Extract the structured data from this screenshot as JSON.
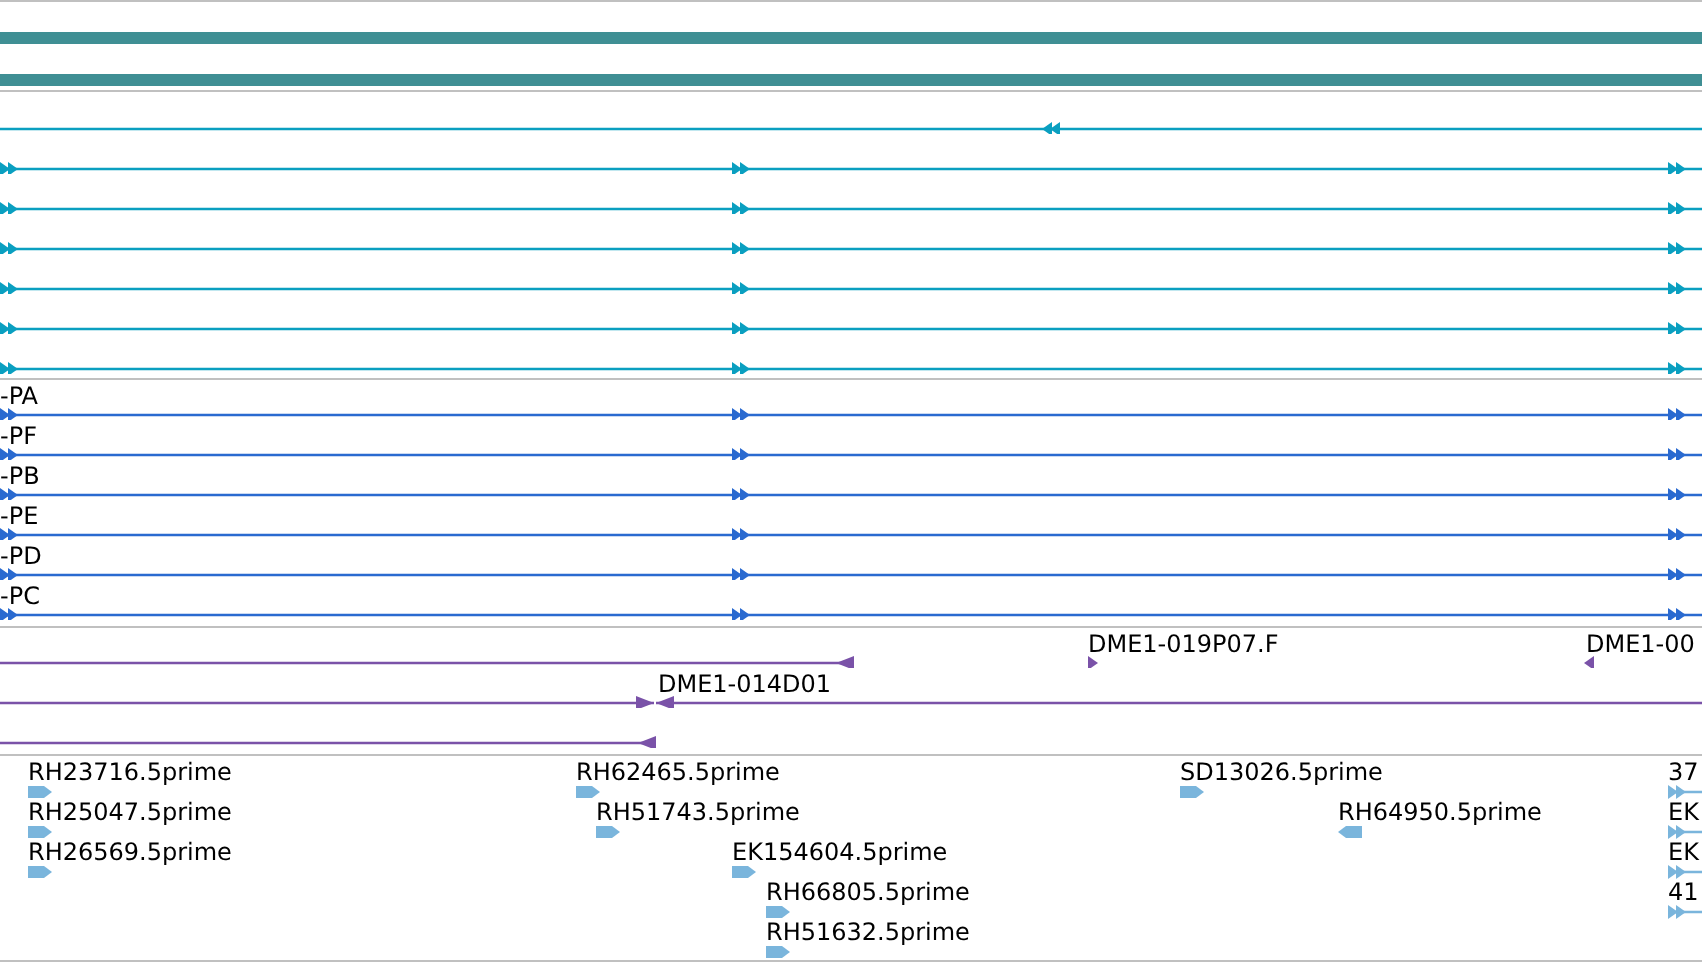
{
  "transcript_track": {
    "rows": [
      {
        "kind": "reverse"
      },
      {
        "kind": "forward"
      },
      {
        "kind": "forward"
      },
      {
        "kind": "forward"
      },
      {
        "kind": "forward"
      },
      {
        "kind": "forward"
      },
      {
        "kind": "forward"
      }
    ]
  },
  "protein_track": {
    "rows": [
      {
        "label": "-PA",
        "kind": "forward"
      },
      {
        "label": "-PF",
        "kind": "forward"
      },
      {
        "label": "-PB",
        "kind": "forward"
      },
      {
        "label": "-PE",
        "kind": "forward"
      },
      {
        "label": "-PD",
        "kind": "forward"
      },
      {
        "label": "-PC",
        "kind": "forward"
      }
    ]
  },
  "clone_track": {
    "rows": [
      {
        "features": [
          {
            "kind": "reverse"
          },
          {
            "label": "DME1-019P07.F",
            "kind": "forward"
          },
          {
            "label": "DME1-00",
            "kind": "reverse"
          }
        ]
      },
      {
        "features": [
          {
            "kind": "forward"
          },
          {
            "label": "DME1-014D01",
            "kind": "reverse"
          }
        ]
      },
      {
        "features": [
          {
            "kind": "reverse"
          }
        ]
      }
    ]
  },
  "est_track": {
    "features": [
      {
        "label": "RH23716.5prime",
        "kind": "forward"
      },
      {
        "label": "RH62465.5prime",
        "kind": "forward"
      },
      {
        "label": "SD13026.5prime",
        "kind": "forward"
      },
      {
        "label": "37",
        "kind": "forward"
      },
      {
        "label": "RH25047.5prime",
        "kind": "forward"
      },
      {
        "label": "RH51743.5prime",
        "kind": "forward"
      },
      {
        "label": "RH64950.5prime",
        "kind": "reverse"
      },
      {
        "label": "EK",
        "kind": "forward"
      },
      {
        "label": "RH26569.5prime",
        "kind": "forward"
      },
      {
        "label": "EK154604.5prime",
        "kind": "forward"
      },
      {
        "label": "EK",
        "kind": "forward"
      },
      {
        "label": "RH66805.5prime",
        "kind": "forward"
      },
      {
        "label": "41",
        "kind": "forward"
      },
      {
        "label": "RH51632.5prime",
        "kind": "forward"
      }
    ]
  }
}
